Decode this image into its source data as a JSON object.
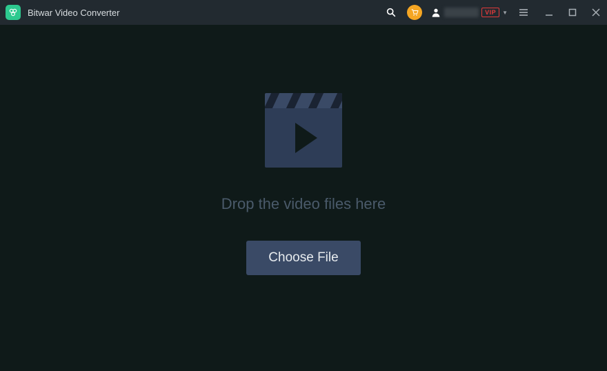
{
  "app": {
    "title": "Bitwar Video Converter"
  },
  "titlebar": {
    "vip_label": "VIP"
  },
  "main": {
    "drop_hint": "Drop the video files here",
    "choose_button": "Choose File"
  }
}
